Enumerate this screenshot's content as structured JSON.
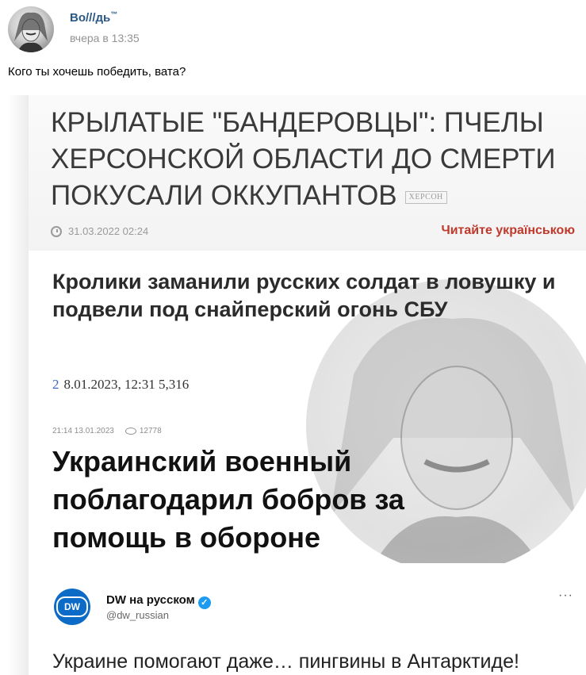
{
  "post": {
    "author": "Во///дь",
    "author_sup": "™",
    "time": "вчера в 13:35",
    "text": "Кого ты хочешь победить, вата?"
  },
  "collage": {
    "article1": {
      "headline": "КРЫЛАТЫЕ \"БАНДЕРОВЦЫ\": ПЧЕЛЫ ХЕРСОНСКОЙ ОБЛАСТИ ДО СМЕРТИ ПОКУСАЛИ ОККУПАНТОВ",
      "tag": "ХЕРСОН",
      "date": "31.03.2022 02:24",
      "read_ukr": "Читайте українською"
    },
    "article2": {
      "headline": "Кролики заманили русских солдат в ловушку и подвели под снайперский огонь СБУ",
      "comments": "2",
      "date": "8.01.2023, 12:31",
      "views": "5,316"
    },
    "article3": {
      "datetime": "21:14 13.01.2023",
      "views": "12778",
      "headline": "Украинский военный поблагодарил бобров за помощь в обороне"
    },
    "tweet": {
      "logo": "DW",
      "name": "DW на русском",
      "handle": "@dw_russian",
      "more": "···",
      "text": "Украине помогают даже… пингвины в Антарктиде!"
    }
  },
  "icons": [
    "avatar",
    "clock-icon",
    "eye-icon",
    "verified-icon",
    "more-icon"
  ],
  "colors": {
    "link": "#2a5885",
    "time": "#939393",
    "ukr_link": "#c0392b",
    "dw_blue": "#0c6bc7",
    "verified": "#1d9bf0"
  }
}
